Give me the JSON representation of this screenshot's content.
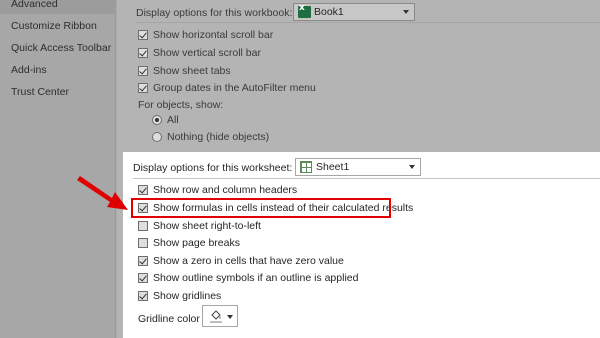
{
  "sidebar": {
    "items": [
      {
        "label": "Advanced"
      },
      {
        "label": "Customize Ribbon"
      },
      {
        "label": "Quick Access Toolbar"
      },
      {
        "label": "Add-ins"
      },
      {
        "label": "Trust Center"
      }
    ]
  },
  "workbook": {
    "heading": "Display options for this workbook:",
    "dropdown_value": "Book1",
    "options": [
      {
        "label": "Show horizontal scroll bar",
        "checked": true
      },
      {
        "label": "Show vertical scroll bar",
        "checked": true
      },
      {
        "label": "Show sheet tabs",
        "checked": true
      },
      {
        "label": "Group dates in the AutoFilter menu",
        "checked": true
      }
    ],
    "objects_label": "For objects, show:",
    "radios": [
      {
        "label": "All",
        "selected": true
      },
      {
        "label": "Nothing (hide objects)",
        "selected": false
      }
    ]
  },
  "worksheet": {
    "heading": "Display options for this worksheet:",
    "dropdown_value": "Sheet1",
    "options": [
      {
        "label": "Show row and column headers",
        "checked": true
      },
      {
        "label": "Show formulas in cells instead of their calculated results",
        "checked": true
      },
      {
        "label": "Show sheet right-to-left",
        "checked": false
      },
      {
        "label": "Show page breaks",
        "checked": false
      },
      {
        "label": "Show a zero in cells that have zero value",
        "checked": true
      },
      {
        "label": "Show outline symbols if an outline is applied",
        "checked": true
      },
      {
        "label": "Show gridlines",
        "checked": true
      }
    ],
    "gridline_color_label": "Gridline color"
  },
  "icons": {
    "workbook_icon": "excel-workbook-icon",
    "sheet_icon": "worksheet-icon",
    "gridline_color_icon": "paint-bucket-icon",
    "annotation_arrow": "red-arrow"
  },
  "colors": {
    "highlight": "#e00000",
    "arrow": "#e00000"
  }
}
